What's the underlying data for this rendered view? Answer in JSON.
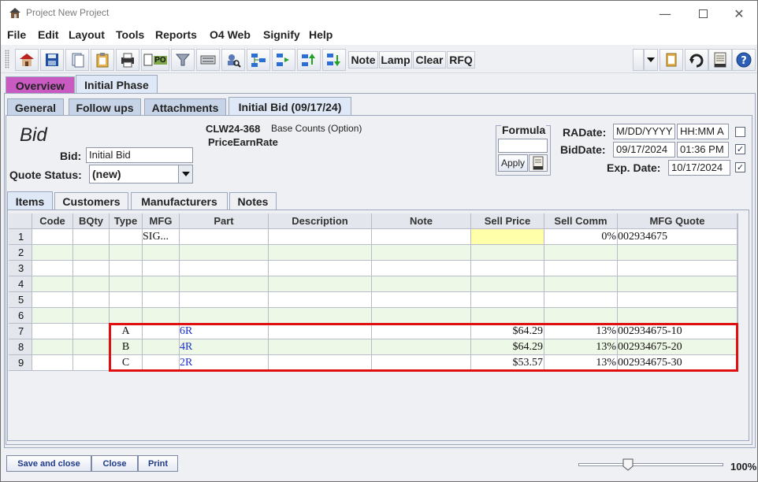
{
  "window": {
    "title": "Project New Project"
  },
  "menu": [
    "File",
    "Edit",
    "Layout",
    "Tools",
    "Reports",
    "O4 Web",
    "Signify",
    "Help"
  ],
  "toolbar": {
    "po_label": "PO",
    "text_buttons": [
      "Note",
      "Lamp",
      "Clear",
      "RFQ"
    ]
  },
  "top_tabs": [
    "Overview",
    "Initial Phase"
  ],
  "sub_tabs": [
    "General",
    "Follow ups",
    "Attachments",
    "Initial Bid (09/17/24)"
  ],
  "bid": {
    "heading": "Bid",
    "bid_label": "Bid:",
    "bid_value": "Initial Bid",
    "quote_status_label": "Quote Status:",
    "quote_status_value": "(new)",
    "code": "CLW24-368",
    "counts": "Base Counts (Option)",
    "price_rate": "PriceEarnRate"
  },
  "formula": {
    "label": "Formula",
    "value": "",
    "apply_label": "Apply"
  },
  "dates": {
    "radate_label": "RADate:",
    "radate_value": "M/DD/YYYY",
    "radate_time": "HH:MM A",
    "radate_checked": false,
    "biddate_label": "BidDate:",
    "biddate_value": "09/17/2024",
    "biddate_time": "01:36 PM",
    "biddate_checked": true,
    "exp_label": "Exp. Date:",
    "exp_value": "10/17/2024",
    "exp_checked": true,
    "check_mark": "✓"
  },
  "item_tabs": [
    "Items",
    "Customers",
    "Manufacturers",
    "Notes"
  ],
  "table": {
    "columns": [
      "",
      "Code",
      "BQty",
      "Type",
      "MFG",
      "Part",
      "Description",
      "Note",
      "Sell Price",
      "Sell Comm",
      "MFG Quote"
    ],
    "rows": [
      [
        "1",
        "",
        "",
        "",
        "SIG...",
        "",
        "",
        "",
        "",
        "0%",
        "002934675"
      ],
      [
        "2",
        "",
        "",
        "",
        "",
        "",
        "",
        "",
        "",
        "",
        ""
      ],
      [
        "3",
        "",
        "",
        "",
        "",
        "",
        "",
        "",
        "",
        "",
        ""
      ],
      [
        "4",
        "",
        "",
        "",
        "",
        "",
        "",
        "",
        "",
        "",
        ""
      ],
      [
        "5",
        "",
        "",
        "",
        "",
        "",
        "",
        "",
        "",
        "",
        ""
      ],
      [
        "6",
        "",
        "",
        "",
        "",
        "",
        "",
        "",
        "",
        "",
        ""
      ],
      [
        "7",
        "",
        "",
        "A",
        "",
        "6R",
        "",
        "",
        "$64.29",
        "13%",
        "002934675-10"
      ],
      [
        "8",
        "",
        "",
        "B",
        "",
        "4R",
        "",
        "",
        "$64.29",
        "13%",
        "002934675-20"
      ],
      [
        "9",
        "",
        "",
        "C",
        "",
        "2R",
        "",
        "",
        "$53.57",
        "13%",
        "002934675-30"
      ]
    ]
  },
  "bottom": {
    "buttons": [
      "Save and close",
      "Close",
      "Print"
    ],
    "zoom": "100%"
  },
  "colors": {
    "accent": "#1f3a8a",
    "overview_tab": "#c95ac2",
    "highlight": "#e01010",
    "row_alt": "#eef8e6",
    "sell_price_yellow": "#ffffaa"
  }
}
